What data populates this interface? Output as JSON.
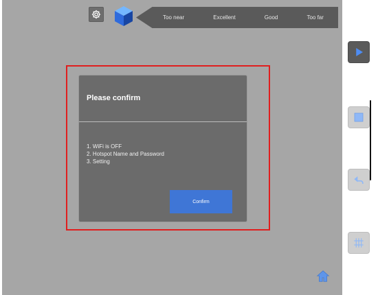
{
  "toolbar": {
    "settings_icon": "gear-icon",
    "cube_icon": "cube-icon",
    "distance_labels": [
      "Too near",
      "Excellent",
      "Good",
      "Too far"
    ]
  },
  "dialog": {
    "title": "Please confirm",
    "lines": [
      "1. WiFi is OFF",
      "2. Hotspot Name and Password",
      "3. Setting"
    ],
    "confirm_label": "Confirm"
  },
  "side_controls": {
    "items": [
      "play-icon",
      "square-icon",
      "undo-icon",
      "grid-icon"
    ]
  },
  "bottom_controls": {
    "home_icon": "home-icon"
  },
  "colors": {
    "workspace": "#a6a6a6",
    "dialog_bg": "#6b6b6b",
    "confirm_button": "#3f76d6",
    "highlight": "#e01e1e",
    "blue_accent": "#2f6bdc"
  }
}
